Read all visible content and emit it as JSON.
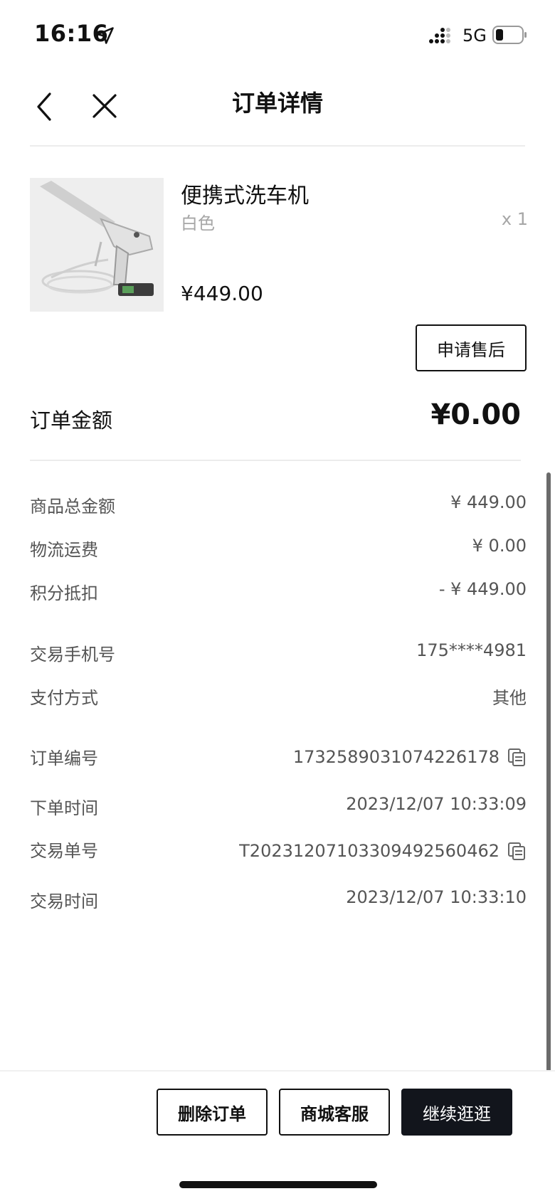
{
  "status_bar": {
    "time": "16:16",
    "network": "5G",
    "icons": [
      "location-arrow-icon",
      "signal-icon",
      "battery-icon"
    ]
  },
  "nav": {
    "title": "订单详情",
    "icons": [
      "back-icon",
      "close-icon"
    ]
  },
  "product": {
    "name": "便携式洗车机",
    "variant": "白色",
    "quantity": "x 1",
    "price": "¥449.00",
    "after_sale_label": "申请售后"
  },
  "order_amount": {
    "label": "订单金额",
    "value": "¥0.00"
  },
  "details": {
    "goods_total": {
      "label": "商品总金额",
      "value": "¥ 449.00"
    },
    "shipping": {
      "label": "物流运费",
      "value": "¥ 0.00"
    },
    "points_deduction": {
      "label": "积分抵扣",
      "value": "- ¥ 449.00"
    },
    "phone": {
      "label": "交易手机号",
      "value": "175****4981"
    },
    "payment_method": {
      "label": "支付方式",
      "value": "其他"
    },
    "order_no": {
      "label": "订单编号",
      "value": "1732589031074226178"
    },
    "order_time": {
      "label": "下单时间",
      "value": "2023/12/07 10:33:09"
    },
    "trade_no": {
      "label": "交易单号",
      "value": "T2023120710330949256​0462"
    },
    "trade_time": {
      "label": "交易时间",
      "value": "2023/12/07 10:33:10"
    }
  },
  "actions": {
    "delete_label": "删除订单",
    "service_label": "商城客服",
    "continue_label": "继续逛逛"
  },
  "colors": {
    "primary_dark": "#12151c",
    "text_secondary": "#555555",
    "text_muted": "#a6a6a6",
    "divider": "#ececec"
  }
}
